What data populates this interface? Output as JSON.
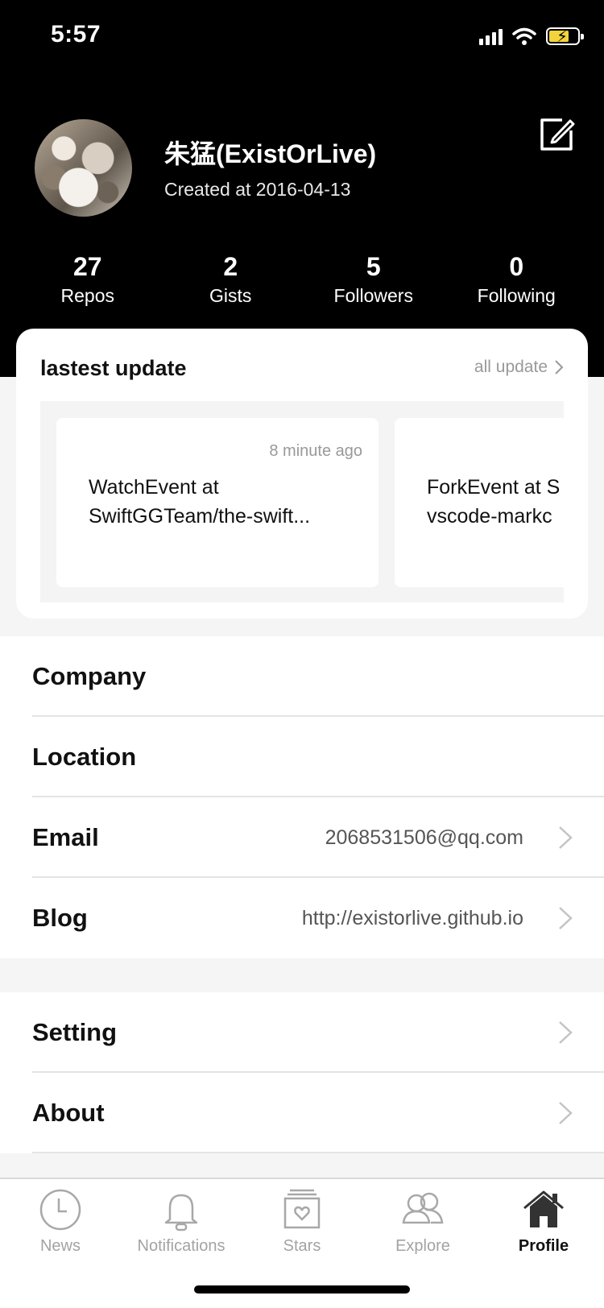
{
  "status_bar": {
    "time": "5:57",
    "accent": "#f2d33b"
  },
  "profile": {
    "name": "朱猛(ExistOrLive)",
    "created": "Created at 2016-04-13",
    "stats": [
      {
        "value": "27",
        "label": "Repos"
      },
      {
        "value": "2",
        "label": "Gists"
      },
      {
        "value": "5",
        "label": "Followers"
      },
      {
        "value": "0",
        "label": "Following"
      }
    ]
  },
  "updates": {
    "title": "lastest update",
    "link": "all update",
    "events": [
      {
        "time": "8 minute ago",
        "text": "WatchEvent at\nSwiftGGTeam/the-swift..."
      },
      {
        "time": "",
        "text": "ForkEvent at S\nvscode-markc"
      }
    ]
  },
  "info": {
    "company": {
      "label": "Company"
    },
    "location": {
      "label": "Location"
    },
    "email": {
      "label": "Email",
      "value": "2068531506@qq.com"
    },
    "blog": {
      "label": "Blog",
      "value": "http://existorlive.github.io"
    }
  },
  "settings": {
    "setting": {
      "label": "Setting"
    },
    "about": {
      "label": "About"
    }
  },
  "tabs": [
    {
      "label": "News",
      "icon": "clock-icon"
    },
    {
      "label": "Notifications",
      "icon": "bell-icon"
    },
    {
      "label": "Stars",
      "icon": "stars-box-icon"
    },
    {
      "label": "Explore",
      "icon": "people-icon"
    },
    {
      "label": "Profile",
      "icon": "home-icon",
      "active": true
    }
  ]
}
